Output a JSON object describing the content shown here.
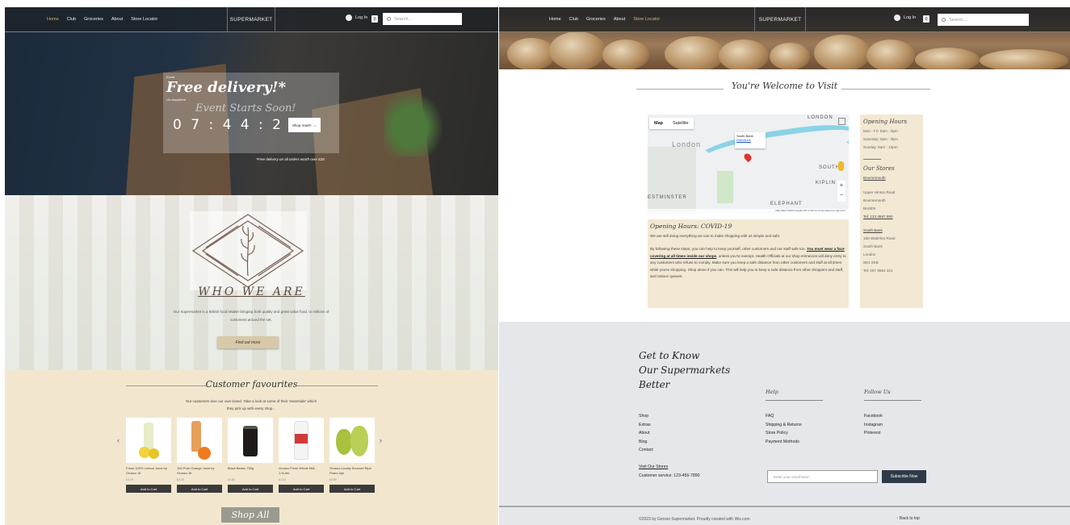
{
  "nav": {
    "links": [
      "Home",
      "Club",
      "Groceries",
      "About",
      "Store Locator"
    ],
    "brand": "SUPERMARKET",
    "login": "Log In",
    "cart_count": "0",
    "search_placeholder": "Search..."
  },
  "hero": {
    "kicker": "Event",
    "headline": "Free delivery!*",
    "everywhere": "On Anywhere",
    "event": "Event Starts Soon!",
    "countdown": "0 7 : 4 4 : 2 4",
    "shop_button": "Shop now!!!",
    "note": "*Free delivery on all orders worth over £20"
  },
  "who": {
    "title": "WHO WE ARE",
    "description": "Our Supermarket is a British food retailer bringing both quality and great value food, to millions of customers around the UK.",
    "button": "Find out more"
  },
  "favourites": {
    "title": "Customer favourites",
    "subtitle": "Our customers love our own brand. Take a look at some of their 'essentials' which they pick up with every shop...",
    "products": [
      {
        "name": "Fresh 100% Lemon Juice by Grosso 1lt",
        "price": "£3.75",
        "cta": "Add to Cart"
      },
      {
        "name": "100 Pure Orange Juice by Grosso 1lt",
        "price": "£3.15",
        "cta": "Add to Cart"
      },
      {
        "name": "Black Beans 750g",
        "price": "£4.50",
        "cta": "Add to Cart"
      },
      {
        "name": "Grosso Fresh Whole Milk 1.5Litre",
        "price": "£1.10",
        "cta": "Add to Cart"
      },
      {
        "name": "Grosso Locally Sourced Ripe Pears 4pk",
        "price": "£2.99",
        "cta": "Add to Cart"
      }
    ],
    "shop_all": "Shop All"
  },
  "visit": {
    "title": "You're Welcome to Visit",
    "map": {
      "tab_map": "Map",
      "tab_satellite": "Satellite",
      "label_london": "London",
      "label_london2": "LONDON",
      "label_westminster": "ESTMINSTER",
      "label_kiplin": "KIPLIN",
      "label_south": "SOUTH",
      "label_elephant": "ELEPHANT",
      "info_title": "South Bank",
      "info_link": "Directions",
      "footer": "Map data ©2023 Google   100 m   Terms of Use   Report a map error"
    },
    "covid": {
      "heading": "Opening Hours: COVID-19",
      "p1": "We are still doing everything we can to make shopping with us simple and safe.",
      "p2a": "By following these steps, you can help to keep yourself, other customers and our staff safe too.",
      "p2b": "You must wear a face covering at all times inside our shops",
      "p2c": ", unless you're exempt. Health Officials at our shop entrances will deny entry to any customers who refuse to comply. Make sure you keep a safe distance from other customers and staff at all times while you're shopping. Shop alone if you can. This will help you to keep a safe distance from other shoppers and staff, and reduce queues."
    },
    "hours": {
      "heading": "Opening Hours",
      "lines": [
        "Mon - Fri: 8am - 8pm",
        "Saturday: 9am - 9pm",
        "Sunday: 9am - 10pm"
      ],
      "stores_heading": "Our Stores",
      "store1": {
        "name": "Bournemouth",
        "lines": [
          "Upper Hinton Road",
          "Bournemouth",
          "BH2EN"
        ],
        "tel": "Tel: 123 4567 890"
      },
      "store2": {
        "name": "South Bank",
        "lines": [
          "158 Waterloo Road",
          "South Bank",
          "London",
          "SE1 8SB"
        ],
        "tel": "Tel: 097 8654 321"
      }
    }
  },
  "footer": {
    "tagline": [
      "Get to Know",
      "Our Supermarkets",
      "Better"
    ],
    "shop_links": [
      "Shop",
      "Extras",
      "About",
      "Blog",
      "Contact"
    ],
    "help_heading": "Help",
    "help_links": [
      "FAQ",
      "Shipping & Returns",
      "Store Policy",
      "Payment Methods"
    ],
    "follow_heading": "Follow Us",
    "follow_links": [
      "Facebook",
      "Instagram",
      "Pinterest"
    ],
    "visit_stores": "Visit Our Stores",
    "service": "Customer service: 123-456-7890",
    "email_placeholder": "Enter your email here*",
    "subscribe": "Subscribe Now",
    "copyright": "©2023 by Grosso Supermarket. Proudly created with Wix.com",
    "back_to_top": "Back to top"
  }
}
